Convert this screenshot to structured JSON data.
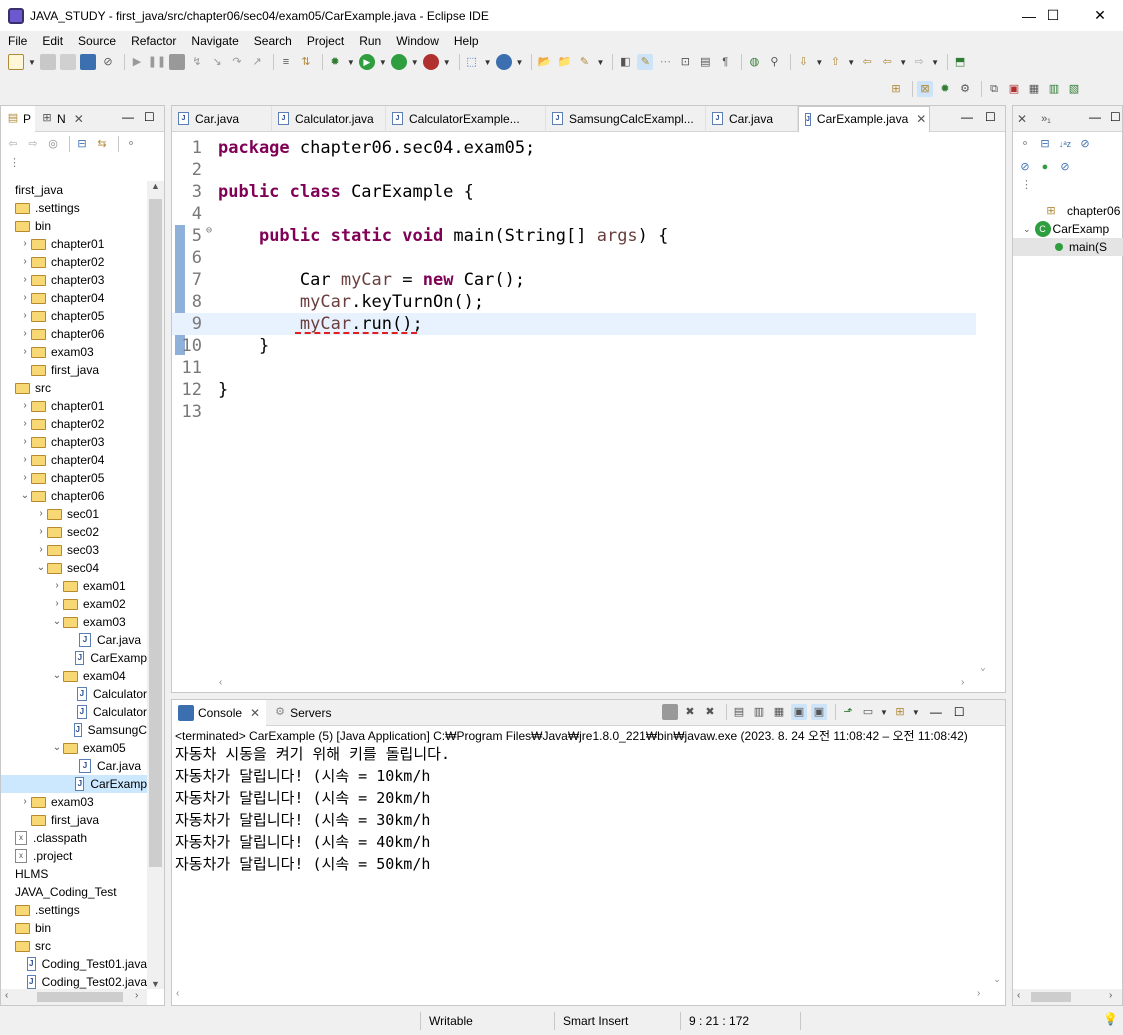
{
  "window": {
    "title": "JAVA_STUDY - first_java/src/chapter06/sec04/exam05/CarExample.java - Eclipse IDE"
  },
  "menu": [
    "File",
    "Edit",
    "Source",
    "Refactor",
    "Navigate",
    "Search",
    "Project",
    "Run",
    "Window",
    "Help"
  ],
  "explorer": {
    "tabs": [
      "P",
      "N"
    ],
    "tree": [
      {
        "label": "first_java",
        "indent": 0,
        "type": "project",
        "chev": ""
      },
      {
        "label": ".settings",
        "indent": 0,
        "type": "folder",
        "chev": ""
      },
      {
        "label": "bin",
        "indent": 0,
        "type": "folder",
        "chev": ""
      },
      {
        "label": "chapter01",
        "indent": 1,
        "type": "folder",
        "chev": "›"
      },
      {
        "label": "chapter02",
        "indent": 1,
        "type": "folder",
        "chev": "›"
      },
      {
        "label": "chapter03",
        "indent": 1,
        "type": "folder",
        "chev": "›"
      },
      {
        "label": "chapter04",
        "indent": 1,
        "type": "folder",
        "chev": "›"
      },
      {
        "label": "chapter05",
        "indent": 1,
        "type": "folder",
        "chev": "›"
      },
      {
        "label": "chapter06",
        "indent": 1,
        "type": "folder",
        "chev": "›"
      },
      {
        "label": "exam03",
        "indent": 1,
        "type": "folder",
        "chev": "›"
      },
      {
        "label": "first_java",
        "indent": 1,
        "type": "folder",
        "chev": ""
      },
      {
        "label": "src",
        "indent": 0,
        "type": "folder",
        "chev": ""
      },
      {
        "label": "chapter01",
        "indent": 1,
        "type": "folder",
        "chev": "›"
      },
      {
        "label": "chapter02",
        "indent": 1,
        "type": "folder",
        "chev": "›"
      },
      {
        "label": "chapter03",
        "indent": 1,
        "type": "folder",
        "chev": "›"
      },
      {
        "label": "chapter04",
        "indent": 1,
        "type": "folder",
        "chev": "›"
      },
      {
        "label": "chapter05",
        "indent": 1,
        "type": "folder",
        "chev": "›"
      },
      {
        "label": "chapter06",
        "indent": 1,
        "type": "folder",
        "chev": "⌄"
      },
      {
        "label": "sec01",
        "indent": 2,
        "type": "folder",
        "chev": "›"
      },
      {
        "label": "sec02",
        "indent": 2,
        "type": "folder",
        "chev": "›"
      },
      {
        "label": "sec03",
        "indent": 2,
        "type": "folder",
        "chev": "›"
      },
      {
        "label": "sec04",
        "indent": 2,
        "type": "folder",
        "chev": "⌄"
      },
      {
        "label": "exam01",
        "indent": 3,
        "type": "folder",
        "chev": "›"
      },
      {
        "label": "exam02",
        "indent": 3,
        "type": "folder",
        "chev": "›"
      },
      {
        "label": "exam03",
        "indent": 3,
        "type": "folder",
        "chev": "⌄"
      },
      {
        "label": "Car.java",
        "indent": 4,
        "type": "java",
        "chev": ""
      },
      {
        "label": "CarExamp",
        "indent": 4,
        "type": "java",
        "chev": ""
      },
      {
        "label": "exam04",
        "indent": 3,
        "type": "folder",
        "chev": "⌄"
      },
      {
        "label": "Calculator",
        "indent": 4,
        "type": "java",
        "chev": ""
      },
      {
        "label": "Calculator",
        "indent": 4,
        "type": "java",
        "chev": ""
      },
      {
        "label": "SamsungC",
        "indent": 4,
        "type": "java",
        "chev": ""
      },
      {
        "label": "exam05",
        "indent": 3,
        "type": "folder",
        "chev": "⌄"
      },
      {
        "label": "Car.java",
        "indent": 4,
        "type": "java",
        "chev": ""
      },
      {
        "label": "CarExamp",
        "indent": 4,
        "type": "java",
        "chev": "",
        "selected": true
      },
      {
        "label": "exam03",
        "indent": 1,
        "type": "folder",
        "chev": "›"
      },
      {
        "label": "first_java",
        "indent": 1,
        "type": "folder",
        "chev": ""
      },
      {
        "label": ".classpath",
        "indent": 0,
        "type": "xml",
        "chev": ""
      },
      {
        "label": ".project",
        "indent": 0,
        "type": "xml",
        "chev": ""
      },
      {
        "label": "HLMS",
        "indent": 0,
        "type": "project",
        "chev": ""
      },
      {
        "label": "JAVA_Coding_Test",
        "indent": 0,
        "type": "project",
        "chev": ""
      },
      {
        "label": ".settings",
        "indent": 0,
        "type": "folder",
        "chev": ""
      },
      {
        "label": "bin",
        "indent": 0,
        "type": "folder",
        "chev": ""
      },
      {
        "label": "src",
        "indent": 0,
        "type": "folder",
        "chev": ""
      },
      {
        "label": "Coding_Test01.java",
        "indent": 1,
        "type": "java",
        "chev": ""
      },
      {
        "label": "Coding_Test02.java",
        "indent": 1,
        "type": "java",
        "chev": ""
      }
    ]
  },
  "editor": {
    "tabs": [
      "Car.java",
      "Calculator.java",
      "CalculatorExample...",
      "SamsungCalcExampl...",
      "Car.java",
      "CarExample.java"
    ],
    "active_tab": 5,
    "lines": [
      {
        "n": "1",
        "html": "<span class=\"kw\">package</span> chapter06.sec04.exam05;"
      },
      {
        "n": "2",
        "html": ""
      },
      {
        "n": "3",
        "html": "<span class=\"kw\">public class</span> CarExample {"
      },
      {
        "n": "4",
        "html": ""
      },
      {
        "n": "5",
        "html": "    <span class=\"kw\">public static void</span> main(String[] <span class=\"fld\">args</span>) {"
      },
      {
        "n": "6",
        "html": ""
      },
      {
        "n": "7",
        "html": "        Car <span class=\"fld\">myCar</span> = <span class=\"kw\">new</span> Car();"
      },
      {
        "n": "8",
        "html": "        <span class=\"fld\">myCar</span>.keyTurnOn();"
      },
      {
        "n": "9",
        "html": "        <span class=\"fld\">myCar</span>.run();"
      },
      {
        "n": "10",
        "html": "    }"
      },
      {
        "n": "11",
        "html": ""
      },
      {
        "n": "12",
        "html": "}"
      },
      {
        "n": "13",
        "html": ""
      }
    ],
    "current_line": 9
  },
  "console": {
    "tabs": [
      "Console",
      "Servers"
    ],
    "status": "<terminated> CarExample (5) [Java Application] C:₩Program Files₩Java₩jre1.8.0_221₩bin₩javaw.exe  (2023. 8. 24 오전 11:08:42 – 오전 11:08:42)",
    "output": [
      "자동차 시동을 켜기 위해 키를 돌립니다.",
      "자동차가 달립니다! (시속 = 10km/h",
      "자동차가 달립니다! (시속 = 20km/h",
      "자동차가 달립니다! (시속 = 30km/h",
      "자동차가 달립니다! (시속 = 40km/h",
      "자동차가 달립니다! (시속 = 50km/h"
    ]
  },
  "outline": {
    "items": [
      "chapter06",
      "CarExamp",
      "main(S"
    ]
  },
  "statusbar": {
    "writable": "Writable",
    "insert_mode": "Smart Insert",
    "position": "9 : 21 : 172"
  }
}
